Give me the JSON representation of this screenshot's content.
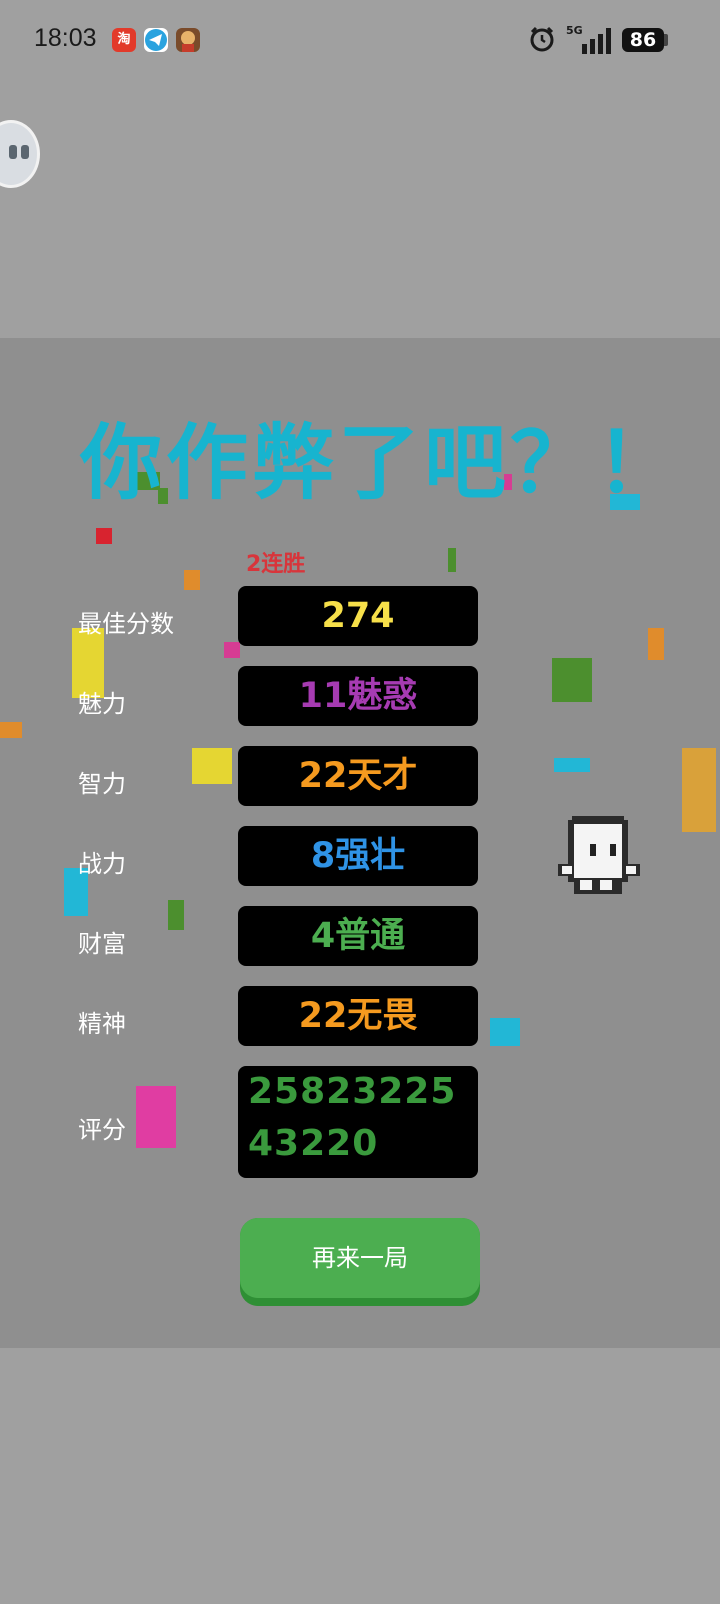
{
  "status_bar": {
    "time": "18:03",
    "network": "5G",
    "battery": "86",
    "notification_icons": [
      "taobao-icon",
      "telegram-icon",
      "game-avatar-icon"
    ],
    "taobao_glyph": "淘"
  },
  "game_over": {
    "title": "你作弊了吧？！",
    "streak": "2连胜",
    "stats": [
      {
        "label": "最佳分数",
        "value": "274",
        "color": "#f7e04a"
      },
      {
        "label": "魅力",
        "value": "11魅惑",
        "color": "#a63bb2"
      },
      {
        "label": "智力",
        "value": "22天才",
        "color": "#f59a1f"
      },
      {
        "label": "战力",
        "value": "8强壮",
        "color": "#2f93e6"
      },
      {
        "label": "财富",
        "value": "4普通",
        "color": "#4cae50"
      },
      {
        "label": "精神",
        "value": "22无畏",
        "color": "#f59a1f"
      }
    ],
    "score_label": "评分",
    "score_value": "2582322543220",
    "score_color": "#3a9a3d",
    "replay_button": "再来一局"
  },
  "colors": {
    "title": "#17b4cf",
    "streak": "#d8353b",
    "button": "#4cae50",
    "panel": "#8f8f8f",
    "page": "#a0a0a0"
  }
}
